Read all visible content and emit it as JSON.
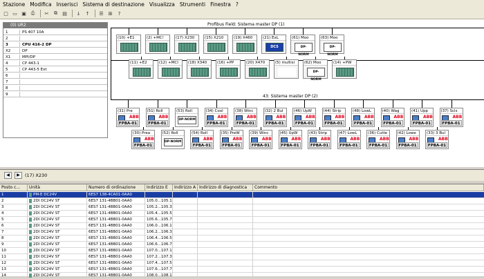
{
  "menu": [
    "Stazione",
    "Modifica",
    "Inserisci",
    "Sistema di destinazione",
    "Visualizza",
    "Strumenti",
    "Finestra",
    "?"
  ],
  "toolbar_icons": [
    "new-icon",
    "open-icon",
    "save-icon",
    "print-icon",
    "cut-icon",
    "copy-icon",
    "paste-icon",
    "download-icon",
    "upload-icon",
    "catalog-icon",
    "network-icon",
    "help-icon"
  ],
  "rack": {
    "title": "(0) UR2",
    "slots": [
      {
        "n": "1",
        "m": "PS 407 10A",
        "bold": false
      },
      {
        "n": "2",
        "m": "",
        "bold": false
      },
      {
        "n": "3",
        "m": "CPU 416-2 DP",
        "bold": true
      },
      {
        "n": "X2",
        "m": "DP",
        "bold": false
      },
      {
        "n": "X1",
        "m": "MPI/DP",
        "bold": false
      },
      {
        "n": "4",
        "m": "CP 443-1",
        "bold": false
      },
      {
        "n": "5",
        "m": "CP 443-5 Ext",
        "bold": false
      },
      {
        "n": "6",
        "m": "",
        "bold": false
      },
      {
        "n": "7",
        "m": "",
        "bold": false
      },
      {
        "n": "8",
        "m": "",
        "bold": false
      },
      {
        "n": "9",
        "m": "",
        "bold": false
      }
    ]
  },
  "bus1": {
    "label": "Profibus Field: Sistema master DP (1)"
  },
  "bus2": {
    "label": "43: Sistema master DP (2)"
  },
  "nodes_row1": [
    {
      "lbl": "(10) +E1",
      "type": "module"
    },
    {
      "lbl": "(2) +MC!",
      "type": "module"
    },
    {
      "lbl": "(17) X230",
      "type": "module"
    },
    {
      "lbl": "(15) X210",
      "type": "module"
    },
    {
      "lbl": "(19) X460",
      "type": "module"
    },
    {
      "lbl": "(21) ExL",
      "type": "dcs",
      "txt": "DCS"
    },
    {
      "lbl": "(61) Moo",
      "type": "norm",
      "txt": "DP-NORM"
    },
    {
      "lbl": "(63) Moo",
      "type": "norm",
      "txt": "DP-NORM"
    }
  ],
  "nodes_row2": [
    {
      "lbl": "(11) +E2",
      "type": "module"
    },
    {
      "lbl": "(12) +MCI",
      "type": "module"
    },
    {
      "lbl": "(18) X340",
      "type": "module"
    },
    {
      "lbl": "(16) +PP",
      "type": "module"
    },
    {
      "lbl": "(20) X470",
      "type": "module"
    },
    {
      "lbl": "(5) multisi",
      "type": "misc"
    },
    {
      "lbl": "(62) Moo",
      "type": "norm",
      "txt": "DP-NORM"
    },
    {
      "lbl": "(14) +PW",
      "type": "module"
    }
  ],
  "fpba_row1": [
    {
      "lbl": "(31) Pre",
      "norm": false
    },
    {
      "lbl": "(51) Roll",
      "norm": false
    },
    {
      "lbl": "(53) Roll",
      "norm": true
    },
    {
      "lbl": "(34) Cool",
      "norm": false
    },
    {
      "lbl": "(38) Winc",
      "norm": false
    },
    {
      "lbl": "(32) 2 Bul",
      "norm": false
    },
    {
      "lbl": "(46) UpW",
      "norm": false
    },
    {
      "lbl": "(44) Strip",
      "norm": false
    },
    {
      "lbl": "(48) LowL",
      "norm": false
    },
    {
      "lbl": "(40) Wag",
      "norm": false
    },
    {
      "lbl": "(41) Upp",
      "norm": false
    },
    {
      "lbl": "(37) Scis",
      "norm": false
    }
  ],
  "fpba_row2": [
    {
      "lbl": "(30) Prea",
      "norm": false
    },
    {
      "lbl": "(52) Roll",
      "norm": true
    },
    {
      "lbl": "(54) Roll",
      "norm": false
    },
    {
      "lbl": "(35) PreW",
      "norm": false
    },
    {
      "lbl": "(39) Winc",
      "norm": false
    },
    {
      "lbl": "(45) UpW",
      "norm": false
    },
    {
      "lbl": "(43) Strip",
      "norm": false
    },
    {
      "lbl": "(47) LowL",
      "norm": false
    },
    {
      "lbl": "(36) Cutte",
      "norm": false
    },
    {
      "lbl": "(42) Lowe",
      "norm": false
    },
    {
      "lbl": "(33) 3 Bul",
      "norm": false
    }
  ],
  "fpba_text": "FPBA-01",
  "abb_text": "ABB",
  "norm_text": "DP-NORM",
  "detail": {
    "title": "(17)  X230"
  },
  "table": {
    "headers": [
      "Posto c...",
      "Unità",
      "Numero di ordinazione",
      "Indirizzo E",
      "Indirizzo A",
      "Indirizzo di diagnostica",
      "Commento"
    ],
    "rows": [
      [
        "1",
        "PM-E DC24V",
        "6ES7 138-4CA01-0AA0",
        "",
        "",
        ""
      ],
      [
        "2",
        "2DI DC24V ST",
        "6ES7 131-4BB01-0AA0",
        "105.0...105.1",
        "",
        ""
      ],
      [
        "3",
        "2DI DC24V ST",
        "6ES7 131-4BB01-0AA0",
        "105.2...105.3",
        "",
        ""
      ],
      [
        "4",
        "2DI DC24V ST",
        "6ES7 131-4BB01-0AA0",
        "105.4...105.5",
        "",
        ""
      ],
      [
        "5",
        "2DI DC24V ST",
        "6ES7 131-4BB01-0AA0",
        "105.6...105.7",
        "",
        ""
      ],
      [
        "6",
        "2DI DC24V ST",
        "6ES7 131-4BB01-0AA0",
        "106.0...106.1",
        "",
        ""
      ],
      [
        "7",
        "2DI DC24V ST",
        "6ES7 131-4BB01-0AA0",
        "106.2...106.3",
        "",
        ""
      ],
      [
        "8",
        "2DI DC24V ST",
        "6ES7 131-4BB01-0AA0",
        "106.4...106.5",
        "",
        ""
      ],
      [
        "9",
        "2DI DC24V ST",
        "6ES7 131-4BB01-0AA0",
        "106.6...106.7",
        "",
        ""
      ],
      [
        "10",
        "2DI DC24V ST",
        "6ES7 131-4BB01-0AA0",
        "107.0...107.1",
        "",
        ""
      ],
      [
        "11",
        "2DI DC24V ST",
        "6ES7 131-4BB01-0AA0",
        "107.2...107.3",
        "",
        ""
      ],
      [
        "12",
        "2DI DC24V ST",
        "6ES7 131-4BB01-0AA0",
        "107.4...107.5",
        "",
        ""
      ],
      [
        "13",
        "2DI DC24V ST",
        "6ES7 131-4BB01-0AA0",
        "107.6...107.7",
        "",
        ""
      ],
      [
        "14",
        "2DI DC24V ST",
        "6ES7 131-4BB01-0AA0",
        "108.0...108.1",
        "",
        ""
      ]
    ]
  },
  "colors": {
    "selection": "#1a3da3",
    "module": "#5a9a85",
    "abb": "#e2001a"
  }
}
